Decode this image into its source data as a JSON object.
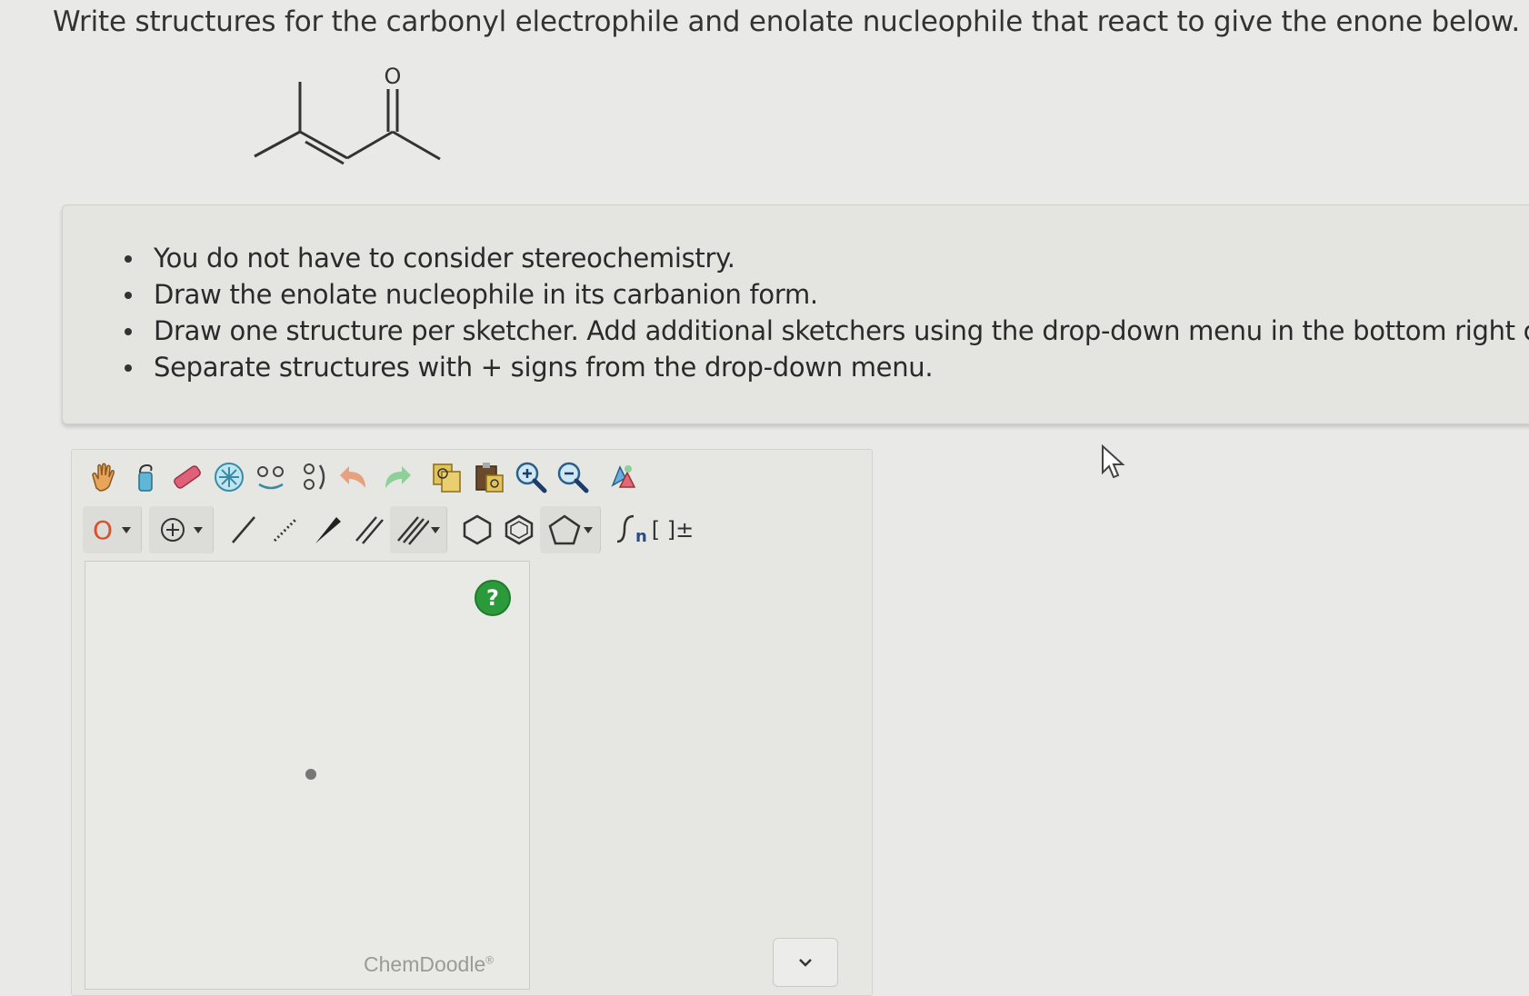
{
  "question": {
    "text": "Write structures for the carbonyl electrophile and enolate nucleophile that react to give the enone below."
  },
  "molecule": {
    "oxygen_label": "O"
  },
  "notes": {
    "items": [
      "You do not have to consider stereochemistry.",
      "Draw the enolate nucleophile in its carbanion form.",
      "Draw one structure per sketcher. Add additional sketchers using the drop-down menu in the bottom right corne",
      "Separate structures with + signs from the drop-down menu."
    ]
  },
  "sketcher": {
    "atom_label": "O",
    "help_label": "?",
    "brand": "ChemDoodle",
    "brand_mark": "®",
    "charge_label": "[ ]±",
    "polymer_label": "n",
    "icons": {
      "row1": [
        "hand-icon",
        "lasso-icon",
        "eraser-icon",
        "center-icon",
        "flip-horizontal-icon",
        "flip-vertical-icon",
        "undo-icon",
        "redo-icon",
        "copy-icon",
        "paste-icon",
        "zoom-in-icon",
        "zoom-out-icon",
        "clean-icon"
      ],
      "row2": [
        "atom-icon",
        "charge-icon",
        "single-bond-icon",
        "hashed-bond-icon",
        "wedge-bond-icon",
        "double-bond-icon",
        "triple-bond-icon",
        "cyclohexane-icon",
        "benzene-icon",
        "cyclopentane-icon",
        "polymer-icon",
        "bracket-icon"
      ]
    }
  },
  "colors": {
    "accent_green": "#2a9a3a",
    "atom_oxygen": "#d9502a"
  }
}
